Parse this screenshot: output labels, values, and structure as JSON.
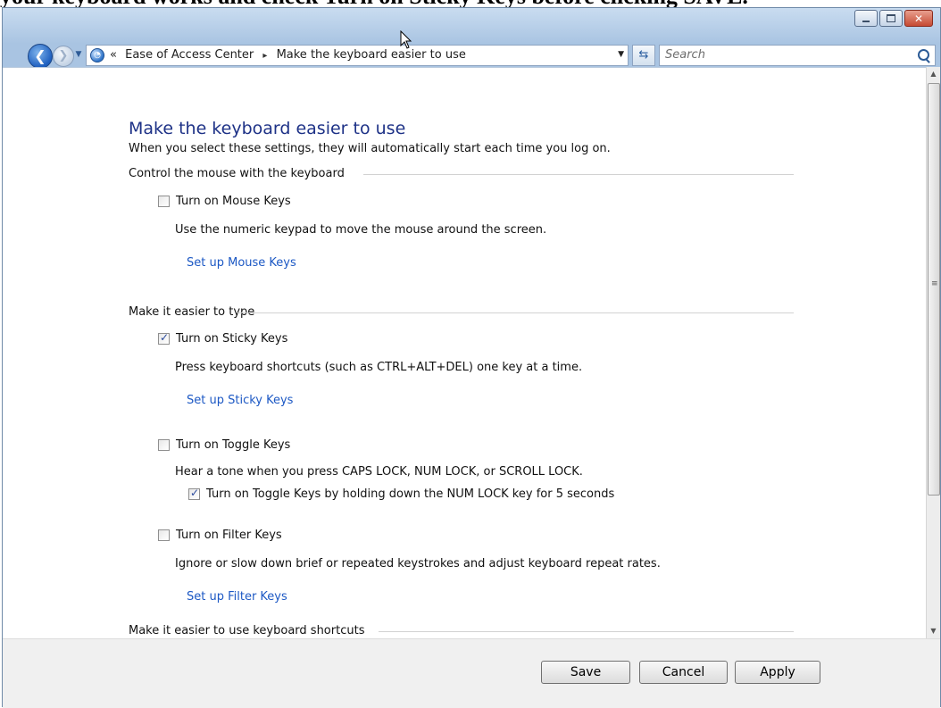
{
  "caption": "your keyboard works and check Turn on Sticky Keys before clicking SAVE.",
  "address": {
    "crumb_overflow": "«",
    "crumb1": "Ease of Access Center",
    "crumb_sep": "▸",
    "crumb2": "Make the keyboard easier to use"
  },
  "search": {
    "placeholder": "Search"
  },
  "page": {
    "title": "Make the keyboard easier to use",
    "subtitle": "When you select these settings, they will automatically start each time you log on."
  },
  "sections": {
    "mouse": {
      "heading": "Control the mouse with the keyboard",
      "mouse_keys": {
        "label": "Turn on Mouse Keys",
        "checked": false
      },
      "mouse_keys_desc": "Use the numeric keypad to move the mouse around the screen.",
      "mouse_keys_link": "Set up Mouse Keys"
    },
    "typing": {
      "heading": "Make it easier to type",
      "sticky_keys": {
        "label": "Turn on Sticky Keys",
        "checked": true
      },
      "sticky_keys_desc": "Press keyboard shortcuts (such as CTRL+ALT+DEL) one key at a time.",
      "sticky_keys_link": "Set up Sticky Keys",
      "toggle_keys": {
        "label": "Turn on Toggle Keys",
        "checked": false
      },
      "toggle_keys_desc": "Hear a tone when you press CAPS LOCK, NUM LOCK, or SCROLL LOCK.",
      "toggle_hold": {
        "label": "Turn on Toggle Keys by holding down the NUM LOCK key for 5 seconds",
        "checked": true
      },
      "filter_keys": {
        "label": "Turn on Filter Keys",
        "checked": false
      },
      "filter_keys_desc": "Ignore or slow down brief or repeated keystrokes and adjust keyboard repeat rates.",
      "filter_keys_link": "Set up Filter Keys"
    },
    "shortcuts": {
      "heading": "Make it easier to use keyboard shortcuts"
    }
  },
  "buttons": {
    "save": "Save",
    "cancel": "Cancel",
    "apply": "Apply"
  },
  "colors": {
    "link": "#1c58c4",
    "title": "#1e3287",
    "frame": "#a9c4e2"
  }
}
